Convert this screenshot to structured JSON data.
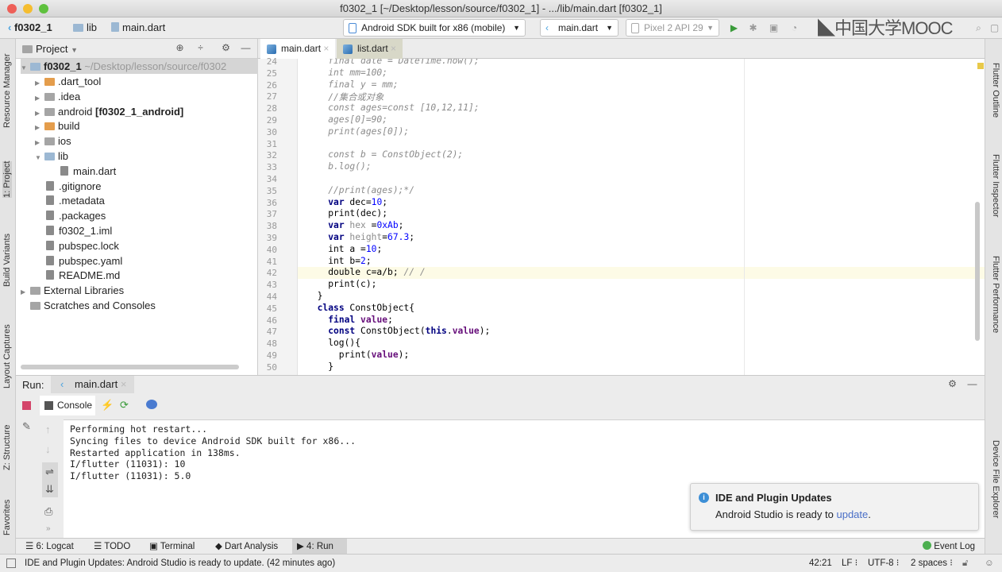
{
  "window": {
    "title": "f0302_1 [~/Desktop/lesson/source/f0302_1] - .../lib/main.dart [f0302_1]"
  },
  "navbar": {
    "breadcrumb": [
      "f0302_1",
      "lib",
      "main.dart"
    ],
    "device_select": "Android SDK built for x86 (mobile)",
    "run_config": "main.dart",
    "avd": "Pixel 2 API 29",
    "watermark": "中国大学MOOC"
  },
  "left_strip": [
    "Resource Manager",
    "1: Project",
    "Build Variants",
    "Layout Captures",
    "Z: Structure",
    "Favorites"
  ],
  "right_strip": [
    "Flutter Outline",
    "Flutter Inspector",
    "Flutter Performance",
    "Device File Explorer"
  ],
  "project": {
    "header": "Project",
    "root": {
      "name": "f0302_1",
      "path": "~/Desktop/lesson/source/f0302"
    },
    "items": [
      {
        "name": ".dart_tool",
        "extra": "",
        "type": "folder-o",
        "level": 1,
        "arrow": "▶"
      },
      {
        "name": ".idea",
        "extra": "",
        "type": "folder-x",
        "level": 1,
        "arrow": "▶"
      },
      {
        "name": "android",
        "extra": "[f0302_1_android]",
        "type": "folder-x",
        "level": 1,
        "arrow": "▶"
      },
      {
        "name": "build",
        "extra": "",
        "type": "folder-o",
        "level": 1,
        "arrow": "▶"
      },
      {
        "name": "ios",
        "extra": "",
        "type": "folder-x",
        "level": 1,
        "arrow": "▶"
      },
      {
        "name": "lib",
        "extra": "",
        "type": "folder",
        "level": 1,
        "arrow": "▼"
      },
      {
        "name": "main.dart",
        "extra": "",
        "type": "dart",
        "level": 2,
        "arrow": ""
      },
      {
        "name": ".gitignore",
        "extra": "",
        "type": "file",
        "level": 1,
        "arrow": ""
      },
      {
        "name": ".metadata",
        "extra": "",
        "type": "file",
        "level": 1,
        "arrow": ""
      },
      {
        "name": ".packages",
        "extra": "",
        "type": "file",
        "level": 1,
        "arrow": ""
      },
      {
        "name": "f0302_1.iml",
        "extra": "",
        "type": "file",
        "level": 1,
        "arrow": ""
      },
      {
        "name": "pubspec.lock",
        "extra": "",
        "type": "file",
        "level": 1,
        "arrow": ""
      },
      {
        "name": "pubspec.yaml",
        "extra": "",
        "type": "file",
        "level": 1,
        "arrow": ""
      },
      {
        "name": "README.md",
        "extra": "",
        "type": "file",
        "level": 1,
        "arrow": ""
      },
      {
        "name": "External Libraries",
        "extra": "",
        "type": "lib",
        "level": 0,
        "arrow": "▶"
      },
      {
        "name": "Scratches and Consoles",
        "extra": "",
        "type": "lib",
        "level": 0,
        "arrow": ""
      }
    ]
  },
  "editor": {
    "tabs": [
      {
        "label": "main.dart",
        "active": true
      },
      {
        "label": "list.dart",
        "active": false
      }
    ],
    "lines": [
      {
        "n": "24",
        "tokens": [
          {
            "t": "    final date = DateTime.now();",
            "k": "cm"
          }
        ]
      },
      {
        "n": "25",
        "tokens": [
          {
            "t": "    int mm=100;",
            "k": "cm"
          }
        ]
      },
      {
        "n": "26",
        "tokens": [
          {
            "t": "    final y = mm;",
            "k": "cm"
          }
        ]
      },
      {
        "n": "27",
        "tokens": [
          {
            "t": "    //集合或对象",
            "k": "cm"
          }
        ]
      },
      {
        "n": "28",
        "tokens": [
          {
            "t": "    const ages=const [10,12,11];",
            "k": "cm"
          }
        ]
      },
      {
        "n": "29",
        "tokens": [
          {
            "t": "    ages[0]=90;",
            "k": "cm"
          }
        ]
      },
      {
        "n": "30",
        "tokens": [
          {
            "t": "    print(ages[0]);",
            "k": "cm"
          }
        ]
      },
      {
        "n": "31",
        "tokens": []
      },
      {
        "n": "32",
        "tokens": [
          {
            "t": "    const b = ConstObject(2);",
            "k": "cm"
          }
        ]
      },
      {
        "n": "33",
        "tokens": [
          {
            "t": "    b.log();",
            "k": "cm"
          }
        ]
      },
      {
        "n": "34",
        "tokens": []
      },
      {
        "n": "35",
        "tokens": [
          {
            "t": "    //print(ages);*/",
            "k": "cm"
          }
        ]
      },
      {
        "n": "36",
        "tokens": [
          {
            "t": "    ",
            "k": ""
          },
          {
            "t": "var",
            "k": "kw"
          },
          {
            "t": " dec=",
            "k": ""
          },
          {
            "t": "10",
            "k": "num"
          },
          {
            "t": ";",
            "k": ""
          }
        ]
      },
      {
        "n": "37",
        "tokens": [
          {
            "t": "    print(dec);",
            "k": ""
          }
        ]
      },
      {
        "n": "38",
        "tokens": [
          {
            "t": "    ",
            "k": ""
          },
          {
            "t": "var",
            "k": "kw"
          },
          {
            "t": " hex ",
            "k": "gray"
          },
          {
            "t": "=",
            "k": ""
          },
          {
            "t": "0xAb",
            "k": "num"
          },
          {
            "t": ";",
            "k": ""
          }
        ]
      },
      {
        "n": "39",
        "tokens": [
          {
            "t": "    ",
            "k": ""
          },
          {
            "t": "var",
            "k": "kw"
          },
          {
            "t": " height",
            "k": "gray"
          },
          {
            "t": "=",
            "k": ""
          },
          {
            "t": "67.3",
            "k": "num"
          },
          {
            "t": ";",
            "k": ""
          }
        ]
      },
      {
        "n": "40",
        "tokens": [
          {
            "t": "    int a =",
            "k": ""
          },
          {
            "t": "10",
            "k": "num"
          },
          {
            "t": ";",
            "k": ""
          }
        ]
      },
      {
        "n": "41",
        "tokens": [
          {
            "t": "    int b=",
            "k": ""
          },
          {
            "t": "2",
            "k": "num"
          },
          {
            "t": ";",
            "k": ""
          }
        ]
      },
      {
        "n": "42",
        "tokens": [
          {
            "t": "    double c=a/b; ",
            "k": ""
          },
          {
            "t": "// /",
            "k": "cm"
          }
        ]
      },
      {
        "n": "43",
        "tokens": [
          {
            "t": "    print(c);",
            "k": ""
          }
        ]
      },
      {
        "n": "44",
        "tokens": [
          {
            "t": "  }",
            "k": ""
          }
        ]
      },
      {
        "n": "45",
        "tokens": [
          {
            "t": "  ",
            "k": ""
          },
          {
            "t": "class",
            "k": "kw"
          },
          {
            "t": " ConstObject{",
            "k": ""
          }
        ]
      },
      {
        "n": "46",
        "tokens": [
          {
            "t": "    ",
            "k": ""
          },
          {
            "t": "final",
            "k": "kw"
          },
          {
            "t": " ",
            "k": ""
          },
          {
            "t": "value",
            "k": "fld"
          },
          {
            "t": ";",
            "k": ""
          }
        ]
      },
      {
        "n": "47",
        "tokens": [
          {
            "t": "    ",
            "k": ""
          },
          {
            "t": "const",
            "k": "kw"
          },
          {
            "t": " ConstObject(",
            "k": ""
          },
          {
            "t": "this",
            "k": "kw"
          },
          {
            "t": ".",
            "k": ""
          },
          {
            "t": "value",
            "k": "fld"
          },
          {
            "t": ");",
            "k": ""
          }
        ]
      },
      {
        "n": "48",
        "tokens": [
          {
            "t": "    log(){",
            "k": ""
          }
        ]
      },
      {
        "n": "49",
        "tokens": [
          {
            "t": "      print(",
            "k": ""
          },
          {
            "t": "value",
            "k": "fld"
          },
          {
            "t": ");",
            "k": ""
          }
        ]
      },
      {
        "n": "50",
        "tokens": [
          {
            "t": "    }",
            "k": ""
          }
        ]
      }
    ],
    "current_line": "42"
  },
  "run": {
    "label": "Run:",
    "tab": "main.dart",
    "console_tab": "Console",
    "output": [
      "Performing hot restart...",
      "Syncing files to device Android SDK built for x86...",
      "Restarted application in 138ms.",
      "I/flutter (11031): 10",
      "I/flutter (11031): 5.0"
    ]
  },
  "notification": {
    "title": "IDE and Plugin Updates",
    "body": "Android Studio is ready to ",
    "link": "update",
    "end": "."
  },
  "tool_windows": [
    "6: Logcat",
    "TODO",
    "Terminal",
    "Dart Analysis",
    "4: Run"
  ],
  "event_log": "Event Log",
  "status": {
    "message": "IDE and Plugin Updates: Android Studio is ready to update. (42 minutes ago)",
    "position": "42:21",
    "line_sep": "LF ⁝",
    "encoding": "UTF-8 ⁝",
    "indent": "2 spaces ⁝"
  }
}
